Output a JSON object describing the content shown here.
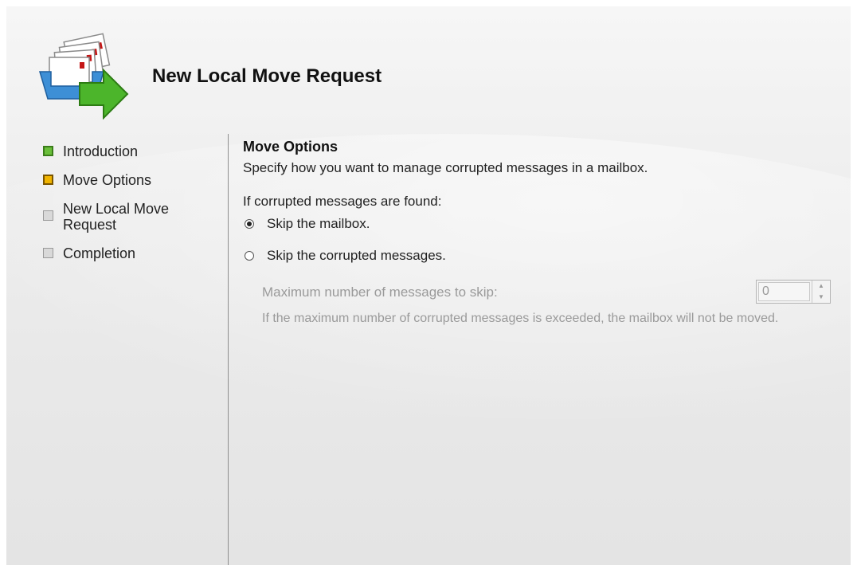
{
  "header": {
    "title": "New Local Move Request",
    "icon": "wizard-move-mailbox-icon"
  },
  "nav": {
    "items": [
      {
        "label": "Introduction",
        "state": "done"
      },
      {
        "label": "Move Options",
        "state": "current"
      },
      {
        "label": "New Local Move Request",
        "state": "pending"
      },
      {
        "label": "Completion",
        "state": "pending"
      }
    ]
  },
  "content": {
    "section_title": "Move Options",
    "description": "Specify how you want to manage corrupted messages in a mailbox.",
    "prompt": "If corrupted messages are found:",
    "options": [
      {
        "label": "Skip the mailbox.",
        "checked": true
      },
      {
        "label": "Skip the corrupted messages.",
        "checked": false
      }
    ],
    "max_skip_label": "Maximum number of messages to skip:",
    "max_skip_value": "0",
    "note": "If the maximum number of corrupted messages is exceeded, the mailbox will not be moved."
  },
  "colors": {
    "done": "#6abf3a",
    "current": "#f0b400",
    "pending": "#d9d9d9",
    "disabled_text": "#9a9a9a"
  }
}
